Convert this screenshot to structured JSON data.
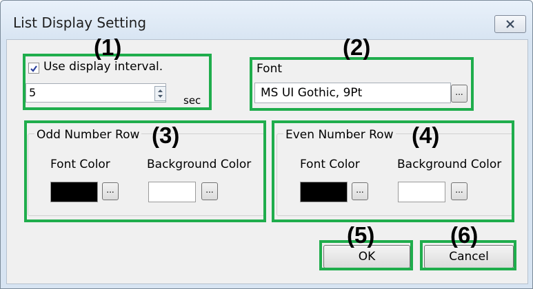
{
  "dialog": {
    "title": "List Display Setting"
  },
  "interval": {
    "checkbox_label": "Use display interval.",
    "checked": true,
    "value": "5",
    "unit": "sec"
  },
  "font": {
    "label": "Font",
    "value": "MS UI Gothic, 9Pt",
    "browse_label": "..."
  },
  "odd_row": {
    "title": "Odd Number Row",
    "font_color_label": "Font Color",
    "background_color_label": "Background Color",
    "font_color": "#000000",
    "background_color": "#ffffff",
    "browse_label": "..."
  },
  "even_row": {
    "title": "Even Number Row",
    "font_color_label": "Font Color",
    "background_color_label": "Background Color",
    "font_color": "#000000",
    "background_color": "#ffffff",
    "browse_label": "..."
  },
  "buttons": {
    "ok": "OK",
    "cancel": "Cancel"
  },
  "annotations": {
    "m1": "(1)",
    "m2": "(2)",
    "m3": "(3)",
    "m4": "(4)",
    "m5": "(5)",
    "m6": "(6)",
    "highlight_color": "#1fad4c"
  }
}
